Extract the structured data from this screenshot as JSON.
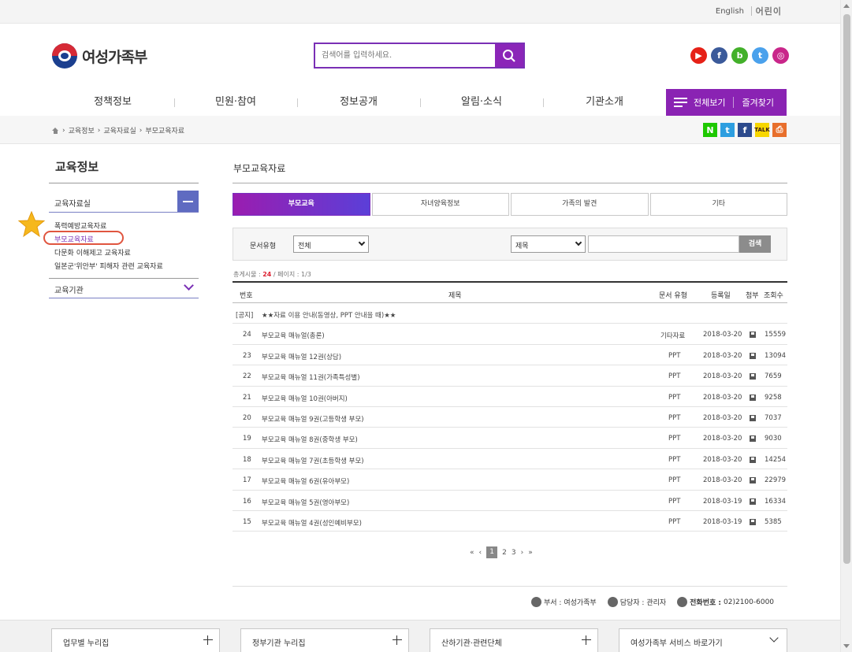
{
  "util": {
    "english": "English",
    "kids": "어린이"
  },
  "logo": {
    "name": "여성가족부"
  },
  "search": {
    "placeholder": "검색어를 입력하세요."
  },
  "social": [
    "youtube-icon",
    "facebook-icon",
    "blog-icon",
    "twitter-icon",
    "instagram-icon"
  ],
  "gnb": {
    "items": [
      "정책정보",
      "민원·참여",
      "정보공개",
      "알림·소식",
      "기관소개"
    ],
    "all_view": "전체보기",
    "favorites": "즐겨찾기"
  },
  "breadcrumb": [
    "교육정보",
    "교육자료실",
    "부모교육자료"
  ],
  "lnb": {
    "title": "교육정보",
    "section1": "교육자료실",
    "subs": [
      "폭력예방교육자료",
      "부모교육자료",
      "다문화 이해제고 교육자료",
      "일본군'위안부' 피해자 관련 교육자료"
    ],
    "section2": "교육기관"
  },
  "content": {
    "title": "부모교육자료",
    "tabs": [
      "부모교육",
      "자녀양육정보",
      "가족의 발견",
      "기타"
    ],
    "filter": {
      "label": "문서유형",
      "type_value": "전체",
      "field_value": "제목",
      "search_button": "검색"
    },
    "count": {
      "prefix": "총게시물 : ",
      "total": "24",
      "suffix": " / 페이지 : 1/3"
    },
    "table": {
      "headers": [
        "번호",
        "제목",
        "문서 유형",
        "등록일",
        "첨부",
        "조회수"
      ],
      "notice": {
        "tag": "[공지]",
        "title": "★★자료 이용 안내(동영상, PPT 안내을 때)★★"
      },
      "rows": [
        {
          "no": "24",
          "title": "부모교육 매뉴얼(총론)",
          "type": "기타자료",
          "date": "2018-03-20",
          "views": "15559"
        },
        {
          "no": "23",
          "title": "부모교육 매뉴얼 12권(상담)",
          "type": "PPT",
          "date": "2018-03-20",
          "views": "13094"
        },
        {
          "no": "22",
          "title": "부모교육 매뉴얼 11권(가족특성별)",
          "type": "PPT",
          "date": "2018-03-20",
          "views": "7659"
        },
        {
          "no": "21",
          "title": "부모교육 매뉴얼 10권(아버지)",
          "type": "PPT",
          "date": "2018-03-20",
          "views": "9258"
        },
        {
          "no": "20",
          "title": "부모교육 매뉴얼 9권(고등학생 부모)",
          "type": "PPT",
          "date": "2018-03-20",
          "views": "7037"
        },
        {
          "no": "19",
          "title": "부모교육 매뉴얼 8권(중학생 부모)",
          "type": "PPT",
          "date": "2018-03-20",
          "views": "9030"
        },
        {
          "no": "18",
          "title": "부모교육 매뉴얼 7권(초등학생 부모)",
          "type": "PPT",
          "date": "2018-03-20",
          "views": "14254"
        },
        {
          "no": "17",
          "title": "부모교육 매뉴얼 6권(유아부모)",
          "type": "PPT",
          "date": "2018-03-20",
          "views": "22979"
        },
        {
          "no": "16",
          "title": "부모교육 매뉴얼 5권(영아부모)",
          "type": "PPT",
          "date": "2018-03-19",
          "views": "16334"
        },
        {
          "no": "15",
          "title": "부모교육 매뉴얼 4권(성인예비부모)",
          "type": "PPT",
          "date": "2018-03-19",
          "views": "5385"
        }
      ]
    },
    "pager": {
      "first": "«",
      "prev": "‹",
      "pages": [
        "1",
        "2",
        "3"
      ],
      "next": "›",
      "last": "»"
    },
    "contact": {
      "dept": "부서 : 여성가족부",
      "manager": "담당자 : 관리자",
      "phone_label": "전화번호 :",
      "phone": "02)2100-6000"
    }
  },
  "footer": [
    "업무별 누리집",
    "정부기관 누리집",
    "산하기관·관련단체",
    "여성가족부 서비스 바로가기"
  ],
  "colors": {
    "brand_purple": "#8a23b3",
    "lnb_blue": "#5f6bc1",
    "highlight_red": "#e0553f"
  }
}
